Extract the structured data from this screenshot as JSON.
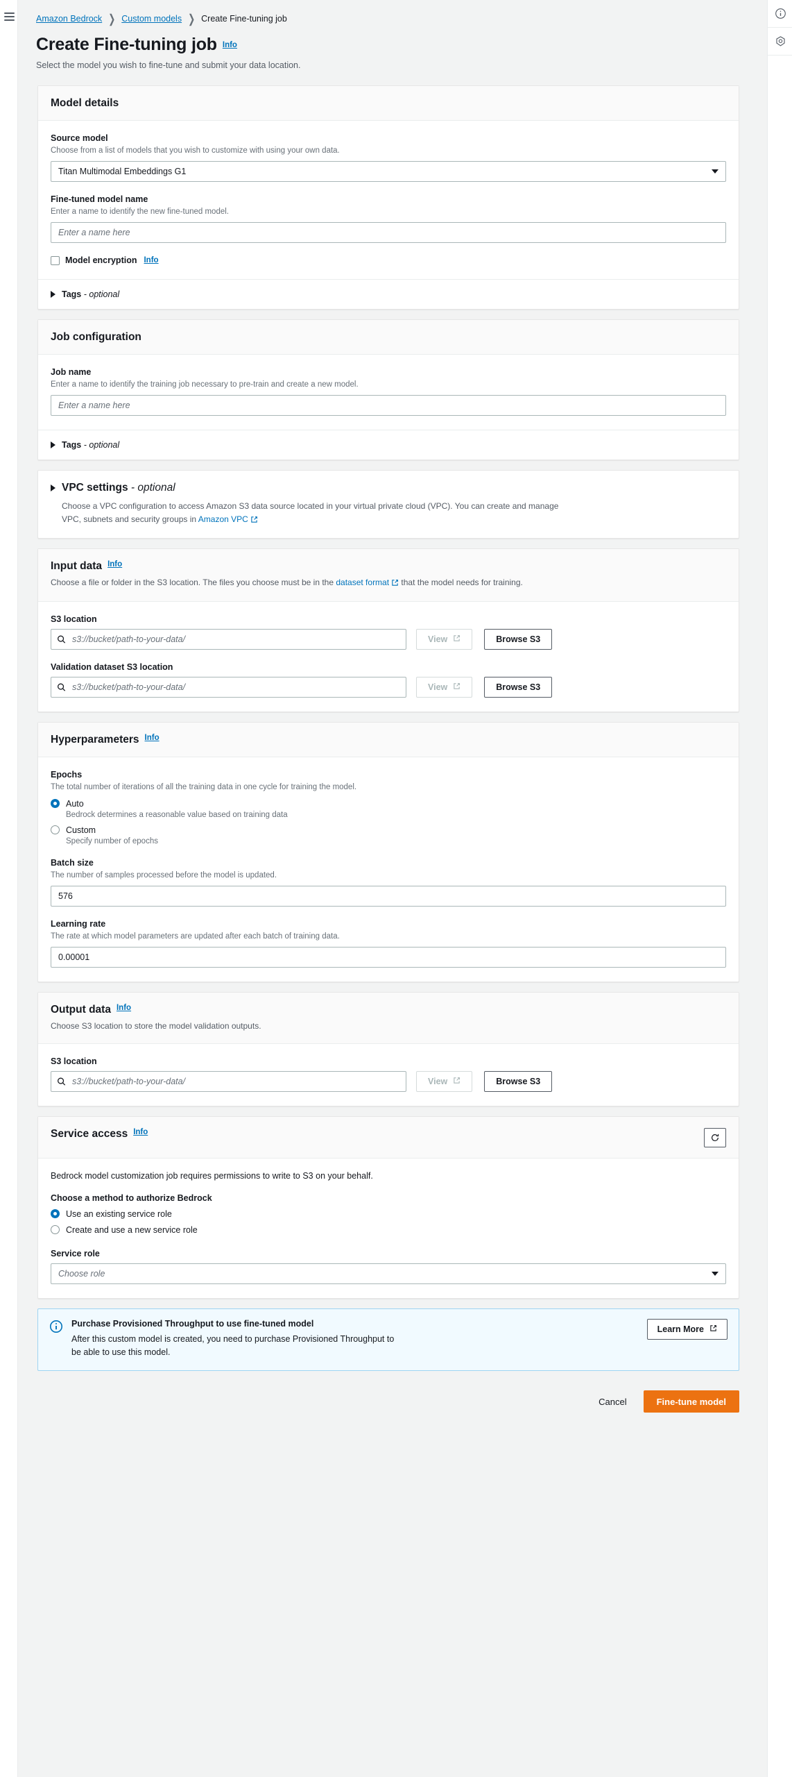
{
  "breadcrumb": {
    "items": [
      {
        "label": "Amazon Bedrock",
        "link": true
      },
      {
        "label": "Custom models",
        "link": true
      },
      {
        "label": "Create Fine-tuning job",
        "link": false
      }
    ],
    "separator": "❯"
  },
  "page": {
    "title": "Create Fine-tuning job",
    "info_label": "Info",
    "subtitle": "Select the model you wish to fine-tune and submit your data location."
  },
  "rail": {
    "menu_icon": "hamburger-menu-icon",
    "info_icon": "info-circle-icon",
    "shield_icon": "shield-icon"
  },
  "model_details": {
    "title": "Model details",
    "source_model": {
      "label": "Source model",
      "hint": "Choose from a list of models that you wish to customize with using your own data.",
      "value": "Titan Multimodal Embeddings G1"
    },
    "model_name": {
      "label": "Fine-tuned model name",
      "hint": "Enter a name to identify the new fine-tuned model.",
      "value": "",
      "placeholder": "Enter a name here"
    },
    "encryption": {
      "label": "Model encryption",
      "info_label": "Info",
      "checked": false
    },
    "tags": {
      "label": "Tags",
      "optional_suffix": "- optional",
      "expanded": false
    }
  },
  "job_configuration": {
    "title": "Job configuration",
    "job_name": {
      "label": "Job name",
      "hint": "Enter a name to identify the training job necessary to pre-train and create a new model.",
      "value": "",
      "placeholder": "Enter a name here"
    },
    "tags": {
      "label": "Tags",
      "optional_suffix": "- optional",
      "expanded": false
    }
  },
  "vpc_settings": {
    "label": "VPC settings",
    "optional_suffix": "- optional",
    "desc_part1": "Choose a VPC configuration to access Amazon S3 data source located in your virtual private cloud (VPC). You can create and manage VPC, subnets and security groups in ",
    "link_label": "Amazon VPC",
    "expanded": false
  },
  "input_data": {
    "title": "Input data",
    "info_label": "Info",
    "desc_part1": "Choose a file or folder in the S3 location. The files you choose must be in the ",
    "desc_link": "dataset format",
    "desc_part2": " that the model needs for training.",
    "s3_location": {
      "label": "S3 location",
      "value": "",
      "placeholder": "s3://bucket/path-to-your-data/"
    },
    "validation_s3_location": {
      "label": "Validation dataset S3 location",
      "value": "",
      "placeholder": "s3://bucket/path-to-your-data/"
    },
    "view_label": "View",
    "browse_label": "Browse S3"
  },
  "hyperparameters": {
    "title": "Hyperparameters",
    "info_label": "Info",
    "epochs": {
      "label": "Epochs",
      "hint": "The total number of iterations of all the training data in one cycle for training the model.",
      "options": [
        {
          "label": "Auto",
          "sub": "Bedrock determines a reasonable value based on training data",
          "selected": true
        },
        {
          "label": "Custom",
          "sub": "Specify number of epochs",
          "selected": false
        }
      ]
    },
    "batch_size": {
      "label": "Batch size",
      "hint": "The number of samples processed before the model is updated.",
      "value": "576"
    },
    "learning_rate": {
      "label": "Learning rate",
      "hint": "The rate at which model parameters are updated after each batch of training data.",
      "value": "0.00001"
    }
  },
  "output_data": {
    "title": "Output data",
    "info_label": "Info",
    "desc": "Choose S3 location to store the model validation outputs.",
    "s3_location": {
      "label": "S3 location",
      "value": "",
      "placeholder": "s3://bucket/path-to-your-data/"
    },
    "view_label": "View",
    "browse_label": "Browse S3"
  },
  "service_access": {
    "title": "Service access",
    "info_label": "Info",
    "refresh_icon": "refresh-icon",
    "desc": "Bedrock model customization job requires permissions to write to S3 on your behalf.",
    "method_label": "Choose a method to authorize Bedrock",
    "options": [
      {
        "label": "Use an existing service role",
        "selected": true
      },
      {
        "label": "Create and use a new service role",
        "selected": false
      }
    ],
    "service_role": {
      "label": "Service role",
      "value": "",
      "placeholder": "Choose role"
    }
  },
  "alert": {
    "icon": "info-filled-icon",
    "title": "Purchase Provisioned Throughput to use fine-tuned model",
    "text": "After this custom model is created, you need to purchase Provisioned Throughput to be able to use this model.",
    "button_label": "Learn More"
  },
  "actions": {
    "cancel_label": "Cancel",
    "submit_label": "Fine-tune model"
  },
  "colors": {
    "accent_link": "#0073bb",
    "primary_button": "#ec7211",
    "page_background": "#f2f3f3",
    "alert_background": "#f1faff"
  }
}
